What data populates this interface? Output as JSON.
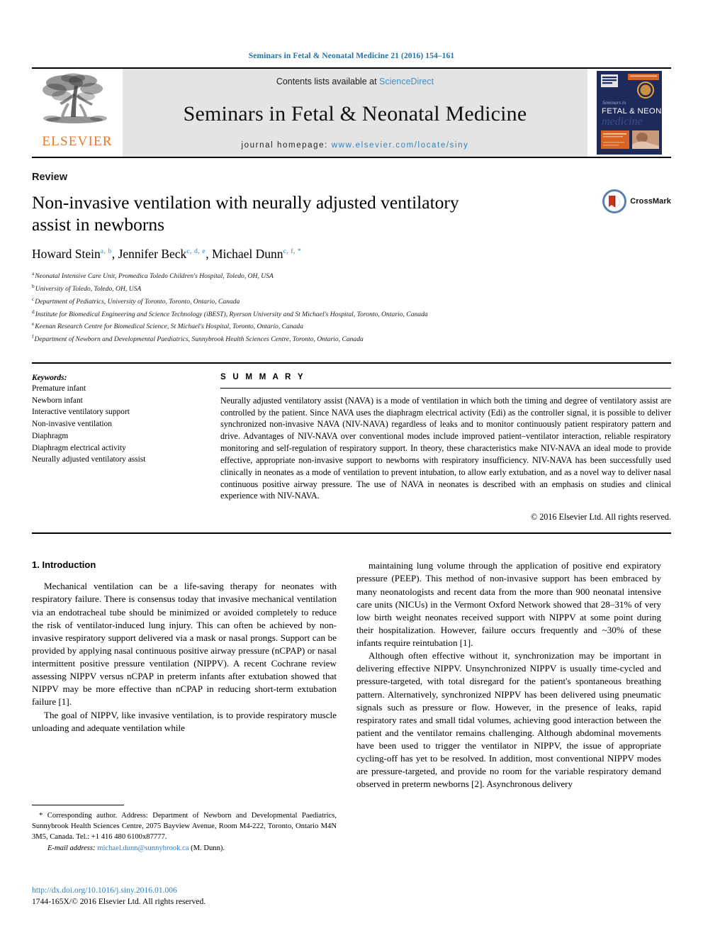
{
  "running_head": "Seminars in Fetal & Neonatal Medicine 21 (2016) 154–161",
  "masthead": {
    "publisher_name": "ELSEVIER",
    "contents_prefix": "Contents lists available at",
    "contents_link": "ScienceDirect",
    "journal_name": "Seminars in Fetal & Neonatal Medicine",
    "homepage_label": "journal homepage:",
    "homepage_url": "www.elsevier.com/locate/siny",
    "cover_title_line1": "FETAL & NEONATAL",
    "cover_title_line2": "medicine",
    "cover_kicker": "Seminars in"
  },
  "article": {
    "type": "Review",
    "title": "Non-invasive ventilation with neurally adjusted ventilatory assist in newborns",
    "authors": [
      {
        "name": "Howard Stein",
        "marks": "a, b"
      },
      {
        "name": "Jennifer Beck",
        "marks": "c, d, e"
      },
      {
        "name": "Michael Dunn",
        "marks": "c, f, *"
      }
    ],
    "authors_plain": "Howard Stein a, b, Jennifer Beck c, d, e, Michael Dunn c, f, *",
    "affiliations": [
      {
        "mark": "a",
        "text": "Neonatal Intensive Care Unit, Promedica Toledo Children's Hospital, Toledo, OH, USA"
      },
      {
        "mark": "b",
        "text": "University of Toledo, Toledo, OH, USA"
      },
      {
        "mark": "c",
        "text": "Department of Pediatrics, University of Toronto, Toronto, Ontario, Canada"
      },
      {
        "mark": "d",
        "text": "Institute for Biomedical Engineering and Science Technology (iBEST), Ryerson University and St Michael's Hospital, Toronto, Ontario, Canada"
      },
      {
        "mark": "e",
        "text": "Keenan Research Centre for Biomedical Science, St Michael's Hospital, Toronto, Ontario, Canada"
      },
      {
        "mark": "f",
        "text": "Department of Newborn and Developmental Paediatrics, Sunnybrook Health Sciences Centre, Toronto, Ontario, Canada"
      }
    ],
    "crossmark_label": "CrossMark"
  },
  "keywords": {
    "title": "Keywords:",
    "items": [
      "Premature infant",
      "Newborn infant",
      "Interactive ventilatory support",
      "Non-invasive ventilation",
      "Diaphragm",
      "Diaphragm electrical activity",
      "Neurally adjusted ventilatory assist"
    ]
  },
  "summary": {
    "heading": "S U M M A R Y",
    "text": "Neurally adjusted ventilatory assist (NAVA) is a mode of ventilation in which both the timing and degree of ventilatory assist are controlled by the patient. Since NAVA uses the diaphragm electrical activity (Edi) as the controller signal, it is possible to deliver synchronized non-invasive NAVA (NIV-NAVA) regardless of leaks and to monitor continuously patient respiratory pattern and drive. Advantages of NIV-NAVA over conventional modes include improved patient–ventilator interaction, reliable respiratory monitoring and self-regulation of respiratory support. In theory, these characteristics make NIV-NAVA an ideal mode to provide effective, appropriate non-invasive support to newborns with respiratory insufficiency. NIV-NAVA has been successfully used clinically in neonates as a mode of ventilation to prevent intubation, to allow early extubation, and as a novel way to deliver nasal continuous positive airway pressure. The use of NAVA in neonates is described with an emphasis on studies and clinical experience with NIV-NAVA.",
    "copyright": "© 2016 Elsevier Ltd. All rights reserved."
  },
  "body": {
    "section_heading": "1. Introduction",
    "left_paragraphs": [
      "Mechanical ventilation can be a life-saving therapy for neonates with respiratory failure. There is consensus today that invasive mechanical ventilation via an endotracheal tube should be minimized or avoided completely to reduce the risk of ventilator-induced lung injury. This can often be achieved by non-invasive respiratory support delivered via a mask or nasal prongs. Support can be provided by applying nasal continuous positive airway pressure (nCPAP) or nasal intermittent positive pressure ventilation (NIPPV). A recent Cochrane review assessing NIPPV versus nCPAP in preterm infants after extubation showed that NIPPV may be more effective than nCPAP in reducing short-term extubation failure [1].",
      "The goal of NIPPV, like invasive ventilation, is to provide respiratory muscle unloading and adequate ventilation while"
    ],
    "right_paragraphs": [
      "maintaining lung volume through the application of positive end expiratory pressure (PEEP). This method of non-invasive support has been embraced by many neonatologists and recent data from the more than 900 neonatal intensive care units (NICUs) in the Vermont Oxford Network showed that 28–31% of very low birth weight neonates received support with NIPPV at some point during their hospitalization. However, failure occurs frequently and ~30% of these infants require reintubation [1].",
      "Although often effective without it, synchronization may be important in delivering effective NIPPV. Unsynchronized NIPPV is usually time-cycled and pressure-targeted, with total disregard for the patient's spontaneous breathing pattern. Alternatively, synchronized NIPPV has been delivered using pneumatic signals such as pressure or flow. However, in the presence of leaks, rapid respiratory rates and small tidal volumes, achieving good interaction between the patient and the ventilator remains challenging. Although abdominal movements have been used to trigger the ventilator in NIPPV, the issue of appropriate cycling-off has yet to be resolved. In addition, most conventional NIPPV modes are pressure-targeted, and provide no room for the variable respiratory demand observed in preterm newborns [2]. Asynchronous delivery"
    ]
  },
  "footnotes": {
    "corresponding": "* Corresponding author. Address: Department of Newborn and Developmental Paediatrics, Sunnybrook Health Sciences Centre, 2075 Bayview Avenue, Room M4-222, Toronto, Ontario M4N 3M5, Canada. Tel.: +1 416 480 6100x87777.",
    "email_label": "E-mail address:",
    "email": "michael.dunn@sunnybrook.ca",
    "email_suffix": "(M. Dunn).",
    "doi": "http://dx.doi.org/10.1016/j.siny.2016.01.006",
    "issn_line": "1744-165X/© 2016 Elsevier Ltd. All rights reserved."
  },
  "colors": {
    "link_blue": "#2e7fc1",
    "running_head_blue": "#1f72a8",
    "elsevier_orange": "#E87722",
    "band_gray": "#e4e4e4",
    "cover_navy": "#1e2a5a"
  }
}
